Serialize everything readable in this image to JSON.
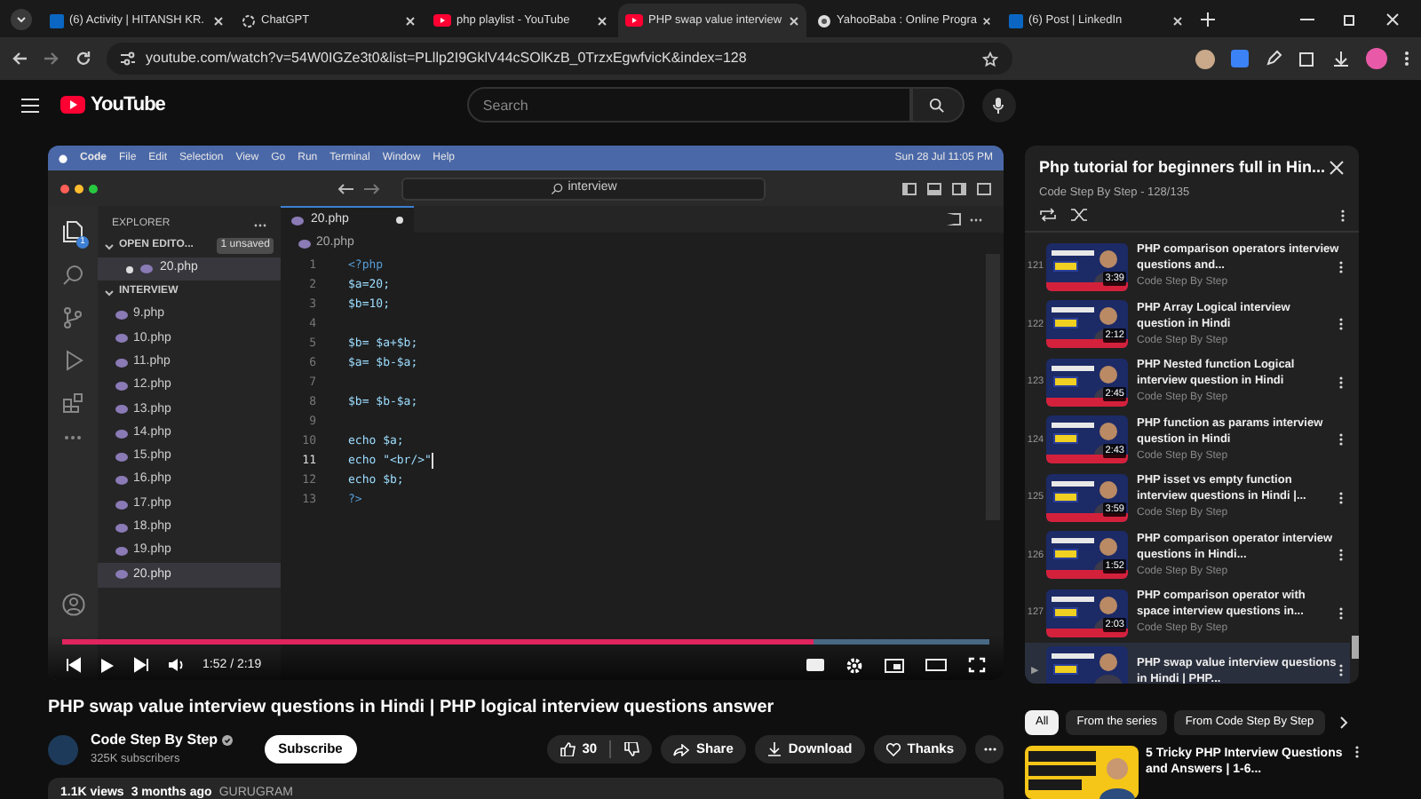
{
  "browser": {
    "tabs": [
      {
        "title": "(6) Activity | HITANSH KR.",
        "kind": "linkedin",
        "selected": false
      },
      {
        "title": "ChatGPT",
        "kind": "chatgpt",
        "selected": false
      },
      {
        "title": "php playlist - YouTube",
        "kind": "youtube",
        "selected": false
      },
      {
        "title": "PHP swap value interview",
        "kind": "youtube",
        "selected": true
      },
      {
        "title": "YahooBaba : Online Progra",
        "kind": "globe",
        "selected": false
      },
      {
        "title": "(6) Post | LinkedIn",
        "kind": "linkedin",
        "selected": false
      }
    ],
    "url": "youtube.com/watch?v=54W0IGZe3t0&list=PLllp2I9GklV44cSOlKzB_0TrzxEgwfvicK&index=128"
  },
  "youtube": {
    "logo": "YouTube",
    "search": {
      "placeholder": "Search"
    }
  },
  "video": {
    "menubar": {
      "items": [
        "Code",
        "File",
        "Edit",
        "Selection",
        "View",
        "Go",
        "Run",
        "Terminal",
        "Window",
        "Help"
      ],
      "clock": "Sun 28 Jul 11:05 PM"
    },
    "command_center": "interview",
    "activity_badge": "1",
    "explorer": {
      "title": "EXPLORER",
      "open_editors": "OPEN EDITO...",
      "unsaved_badge": "1 unsaved",
      "open_files": [
        {
          "name": "20.php",
          "modified": true
        }
      ],
      "folder": "INTERVIEW",
      "files": [
        {
          "name": "9.php",
          "selected": false
        },
        {
          "name": "10.php",
          "selected": false
        },
        {
          "name": "11.php",
          "selected": false
        },
        {
          "name": "12.php",
          "selected": false
        },
        {
          "name": "13.php",
          "selected": false
        },
        {
          "name": "14.php",
          "selected": false
        },
        {
          "name": "15.php",
          "selected": false
        },
        {
          "name": "16.php",
          "selected": false
        },
        {
          "name": "17.php",
          "selected": false
        },
        {
          "name": "18.php",
          "selected": false
        },
        {
          "name": "19.php",
          "selected": false
        },
        {
          "name": "20.php",
          "selected": true
        }
      ]
    },
    "editor": {
      "tab": {
        "name": "20.php",
        "modified": true
      },
      "breadcrumb": "20.php",
      "lines": [
        {
          "number": "1",
          "text": "<?php",
          "kind": "tag",
          "current": false
        },
        {
          "number": "2",
          "text": "$a=20;",
          "kind": "code",
          "current": false
        },
        {
          "number": "3",
          "text": "$b=10;",
          "kind": "code",
          "current": false
        },
        {
          "number": "4",
          "current": false
        },
        {
          "number": "5",
          "text": "$b= $a+$b;",
          "kind": "code",
          "current": false
        },
        {
          "number": "6",
          "text": "$a= $b-$a;",
          "kind": "code",
          "current": false
        },
        {
          "number": "7",
          "current": false
        },
        {
          "number": "8",
          "text": "$b= $b-$a;",
          "kind": "code",
          "current": false
        },
        {
          "number": "9",
          "current": false
        },
        {
          "number": "10",
          "text": "echo $a;",
          "kind": "code",
          "current": false
        },
        {
          "number": "11",
          "text": "echo \"<br/>\"",
          "kind": "code",
          "current": true
        },
        {
          "number": "12",
          "text": "echo $b;",
          "kind": "code",
          "current": false
        },
        {
          "number": "13",
          "text": "?>",
          "kind": "tag",
          "current": false
        }
      ]
    },
    "player": {
      "time": "1:52 / 2:19",
      "level": 0.81
    }
  },
  "title": "PHP swap value interview questions in Hindi | PHP logical interview questions answer",
  "channel": {
    "name": "Code Step By Step",
    "subscribers": "325K subscribers",
    "subscribe": "Subscribe"
  },
  "actions": {
    "likes": "30",
    "share": "Share",
    "download": "Download",
    "thanks": "Thanks"
  },
  "description": {
    "views": "1.1K views",
    "age": "3 months ago",
    "location": "GURUGRAM"
  },
  "playlist": {
    "title": "Php tutorial for beginners full in Hin...",
    "subtitle": "Code Step By Step - 128/135",
    "items": [
      {
        "index": "121",
        "title": "PHP comparison operators interview questions and...",
        "channel": "Code Step By Step",
        "duration": "3:39",
        "selected": false
      },
      {
        "index": "122",
        "title": "PHP Array Logical interview question in Hindi",
        "channel": "Code Step By Step",
        "duration": "2:12",
        "selected": false
      },
      {
        "index": "123",
        "title": "PHP Nested function Logical interview question in Hindi",
        "channel": "Code Step By Step",
        "duration": "2:45",
        "selected": false
      },
      {
        "index": "124",
        "title": "PHP function as params interview question in Hindi",
        "channel": "Code Step By Step",
        "duration": "2:43",
        "selected": false
      },
      {
        "index": "125",
        "title": "PHP isset vs empty function interview questions in Hindi |...",
        "channel": "Code Step By Step",
        "duration": "3:59",
        "selected": false
      },
      {
        "index": "126",
        "title": "PHP comparison operator interview questions in Hindi...",
        "channel": "Code Step By Step",
        "duration": "1:52",
        "selected": false
      },
      {
        "index": "127",
        "title": "PHP comparison operator with space interview questions in...",
        "channel": "Code Step By Step",
        "duration": "2:03",
        "selected": false
      },
      {
        "index": "▶",
        "title": "PHP swap value interview questions in Hindi | PHP...",
        "selected": true
      }
    ]
  },
  "chips": [
    {
      "label": "All",
      "selected": true
    },
    {
      "label": "From the series",
      "selected": false
    },
    {
      "label": "From Code Step By Step",
      "selected": false
    }
  ],
  "recommended": [
    {
      "title": "5 Tricky PHP Interview Questions and Answers | 1-6..."
    }
  ]
}
